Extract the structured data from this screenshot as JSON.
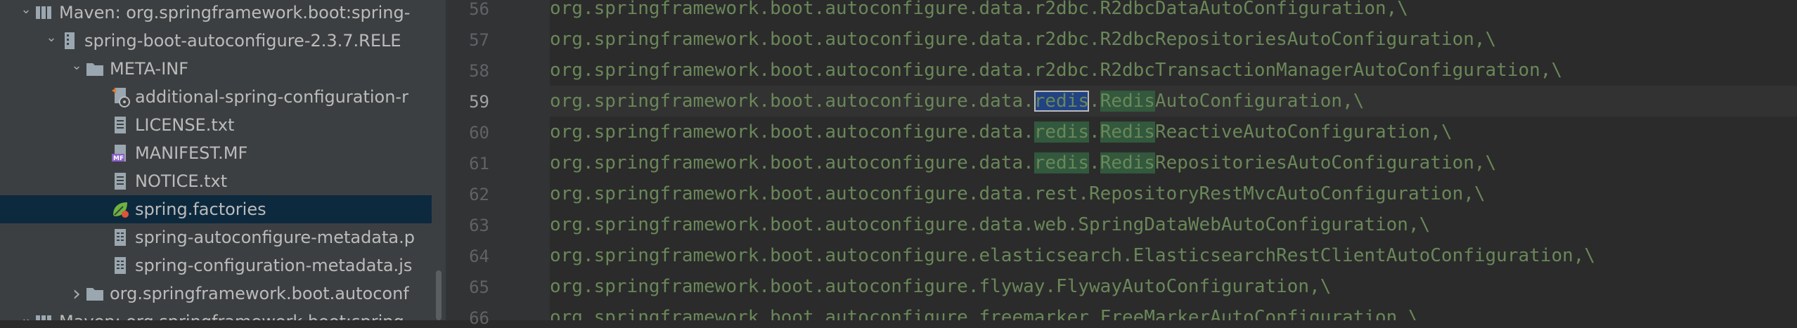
{
  "project_tree": {
    "rows": [
      {
        "label": "Maven: org.springframework.boot:spring-",
        "icon": "library-icon",
        "indent": 0,
        "arrow": "open"
      },
      {
        "label": "spring-boot-autoconfigure-2.3.7.RELE",
        "icon": "jar-icon",
        "indent": 1,
        "arrow": "open"
      },
      {
        "label": "META-INF",
        "icon": "folder-icon",
        "indent": 2,
        "arrow": "open"
      },
      {
        "label": "additional-spring-configuration-r",
        "icon": "json-file-icon",
        "indent": 3,
        "arrow": ""
      },
      {
        "label": "LICENSE.txt",
        "icon": "text-file-icon",
        "indent": 3,
        "arrow": ""
      },
      {
        "label": "MANIFEST.MF",
        "icon": "manifest-file-icon",
        "indent": 3,
        "arrow": ""
      },
      {
        "label": "NOTICE.txt",
        "icon": "text-file-icon",
        "indent": 3,
        "arrow": ""
      },
      {
        "label": "spring.factories",
        "icon": "spring-file-icon",
        "indent": 3,
        "arrow": "",
        "selected": true
      },
      {
        "label": "spring-autoconfigure-metadata.p",
        "icon": "properties-file-icon",
        "indent": 3,
        "arrow": ""
      },
      {
        "label": "spring-configuration-metadata.js",
        "icon": "properties-file-icon",
        "indent": 3,
        "arrow": ""
      },
      {
        "label": "org.springframework.boot.autoconf",
        "icon": "folder-icon",
        "indent": 2,
        "arrow": "closed"
      },
      {
        "label": "Maven: org.springframework.boot:spring-",
        "icon": "library-icon",
        "indent": 0,
        "arrow": "open"
      }
    ]
  },
  "editor": {
    "lines": [
      {
        "num": "56",
        "segments": [
          {
            "t": "org.springframework.boot.autoconfigure.data.r2dbc.R2dbcDataAutoConfiguration,\\"
          }
        ]
      },
      {
        "num": "57",
        "segments": [
          {
            "t": "org.springframework.boot.autoconfigure.data.r2dbc.R2dbcRepositoriesAutoConfiguration,\\"
          }
        ]
      },
      {
        "num": "58",
        "segments": [
          {
            "t": "org.springframework.boot.autoconfigure.data.r2dbc.R2dbcTransactionManagerAutoConfiguration,\\"
          }
        ]
      },
      {
        "num": "59",
        "current": true,
        "segments": [
          {
            "t": "org.springframework.boot.autoconfigure.data."
          },
          {
            "t": "redis",
            "hl": "sel"
          },
          {
            "t": "."
          },
          {
            "t": "Redis",
            "hl": "match"
          },
          {
            "t": "AutoConfiguration,\\"
          }
        ]
      },
      {
        "num": "60",
        "segments": [
          {
            "t": "org.springframework.boot.autoconfigure.data."
          },
          {
            "t": "redis",
            "hl": "match"
          },
          {
            "t": "."
          },
          {
            "t": "Redis",
            "hl": "match"
          },
          {
            "t": "ReactiveAutoConfiguration,\\"
          }
        ]
      },
      {
        "num": "61",
        "segments": [
          {
            "t": "org.springframework.boot.autoconfigure.data."
          },
          {
            "t": "redis",
            "hl": "match"
          },
          {
            "t": "."
          },
          {
            "t": "Redis",
            "hl": "match"
          },
          {
            "t": "RepositoriesAutoConfiguration,\\"
          }
        ]
      },
      {
        "num": "62",
        "segments": [
          {
            "t": "org.springframework.boot.autoconfigure.data.rest.RepositoryRestMvcAutoConfiguration,\\"
          }
        ]
      },
      {
        "num": "63",
        "segments": [
          {
            "t": "org.springframework.boot.autoconfigure.data.web.SpringDataWebAutoConfiguration,\\"
          }
        ]
      },
      {
        "num": "64",
        "segments": [
          {
            "t": "org.springframework.boot.autoconfigure.elasticsearch.ElasticsearchRestClientAutoConfiguration,\\"
          }
        ]
      },
      {
        "num": "65",
        "segments": [
          {
            "t": "org.springframework.boot.autoconfigure.flyway.FlywayAutoConfiguration,\\"
          }
        ]
      },
      {
        "num": "66",
        "segments": [
          {
            "t": "org.springframework.boot.autoconfigure.freemarker.FreeMarkerAutoConfiguration,\\"
          }
        ]
      }
    ]
  },
  "colors": {
    "code_text": "#6a8759",
    "match_highlight": "#32593d",
    "selection_highlight": "#214283",
    "tree_selection": "#0d293e"
  }
}
